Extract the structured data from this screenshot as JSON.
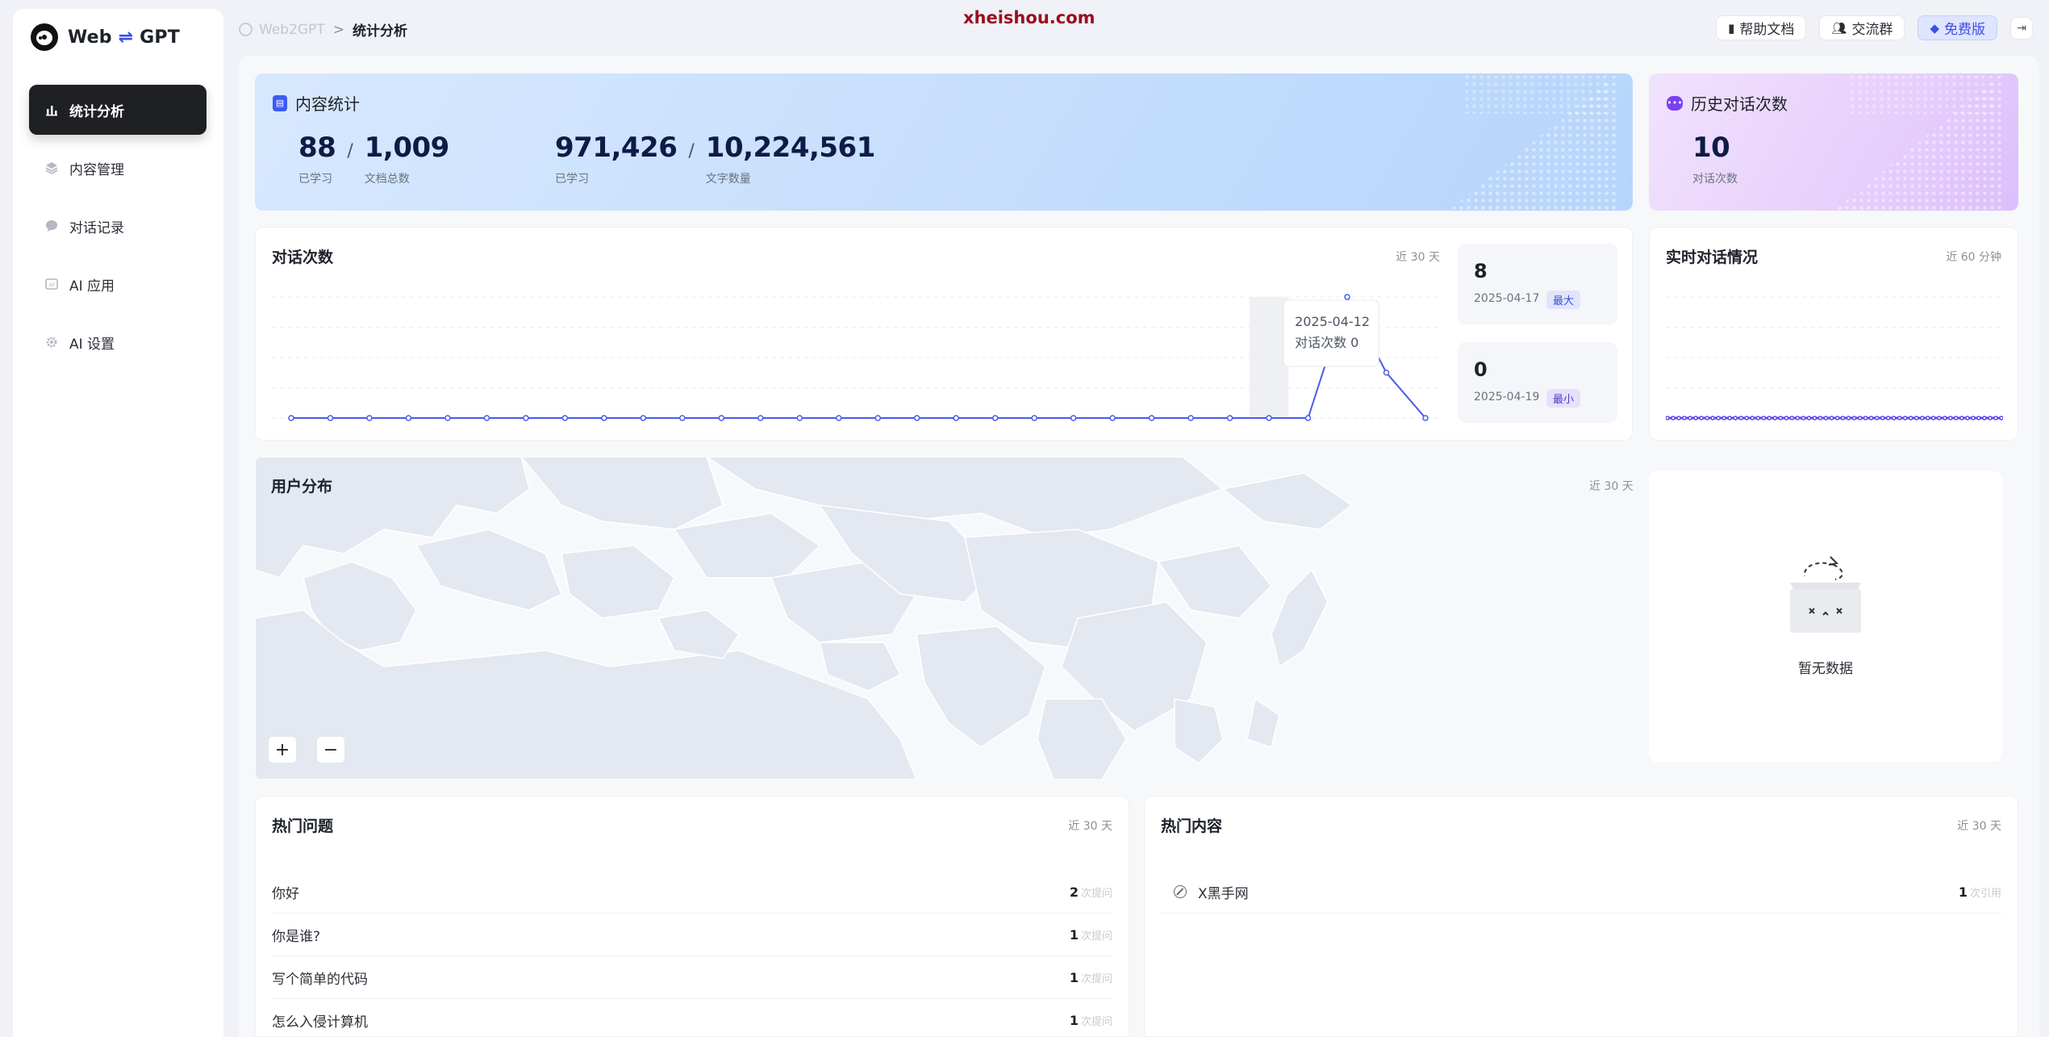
{
  "app": {
    "logo_text_left": "Web",
    "logo_swap": "⇌",
    "logo_text_right": "GPT"
  },
  "sidebar": {
    "items": [
      {
        "label": "统计分析",
        "icon": "bar-chart-icon",
        "active": true
      },
      {
        "label": "内容管理",
        "icon": "layers-icon",
        "active": false
      },
      {
        "label": "对话记录",
        "icon": "chat-bubble-icon",
        "active": false
      },
      {
        "label": "AI 应用",
        "icon": "ai-app-icon",
        "active": false
      },
      {
        "label": "AI 设置",
        "icon": "settings-gear-icon",
        "active": false
      }
    ]
  },
  "breadcrumb": {
    "home": "Web2GPT",
    "separator": ">",
    "current": "统计分析"
  },
  "watermark": "xheishou.com",
  "top_actions": {
    "help": "帮助文档",
    "community": "交流群",
    "plan": "免费版"
  },
  "content_stats": {
    "title": "内容统计",
    "learned_docs": "88",
    "learned_docs_label": "已学习",
    "total_docs": "1,009",
    "total_docs_label": "文档总数",
    "learned_chars": "971,426",
    "learned_chars_label": "已学习",
    "total_chars": "10,224,561",
    "total_chars_label": "文字数量",
    "slash": "/"
  },
  "history_stats": {
    "title": "历史对话次数",
    "count": "10",
    "label": "对话次数"
  },
  "conversation_chart": {
    "title": "对话次数",
    "range": "近 30 天",
    "tooltip_date": "2025-04-12",
    "tooltip_text": "对话次数 0",
    "max_value": "8",
    "max_date": "2025-04-17",
    "max_tag": "最大",
    "min_value": "0",
    "min_date": "2025-04-19",
    "min_tag": "最小"
  },
  "realtime": {
    "title": "实时对话情况",
    "range": "近 60 分钟"
  },
  "user_distribution": {
    "title": "用户分布",
    "range": "近 30 天",
    "zoom_in": "+",
    "zoom_out": "−",
    "empty_text": "暂无数据"
  },
  "hot_questions": {
    "title": "热门问题",
    "range": "近 30 天",
    "unit": "次提问",
    "rows": [
      {
        "text": "你好",
        "count": "2"
      },
      {
        "text": "你是谁?",
        "count": "1"
      },
      {
        "text": "写个简单的代码",
        "count": "1"
      },
      {
        "text": "怎么入侵计算机",
        "count": "1"
      }
    ]
  },
  "hot_content": {
    "title": "热门内容",
    "range": "近 30 天",
    "unit": "次引用",
    "rows": [
      {
        "text": "X黑手网",
        "count": "1"
      }
    ]
  },
  "chart_data": [
    {
      "type": "line",
      "title": "对话次数",
      "x_count": 30,
      "values": [
        0,
        0,
        0,
        0,
        0,
        0,
        0,
        0,
        0,
        0,
        0,
        0,
        0,
        0,
        0,
        0,
        0,
        0,
        0,
        0,
        0,
        0,
        0,
        0,
        0,
        0,
        0,
        8,
        3,
        0
      ],
      "ylim": [
        0,
        8
      ],
      "grid": true,
      "highlight_index": 25,
      "color": "#4a5be8"
    },
    {
      "type": "line",
      "title": "实时对话情况",
      "x_count": 60,
      "values": [
        0,
        0,
        0,
        0,
        0,
        0,
        0,
        0,
        0,
        0,
        0,
        0,
        0,
        0,
        0,
        0,
        0,
        0,
        0,
        0,
        0,
        0,
        0,
        0,
        0,
        0,
        0,
        0,
        0,
        0,
        0,
        0,
        0,
        0,
        0,
        0,
        0,
        0,
        0,
        0,
        0,
        0,
        0,
        0,
        0,
        0,
        0,
        0,
        0,
        0,
        0,
        0,
        0,
        0,
        0,
        0,
        0,
        0,
        0,
        0
      ],
      "ylim": [
        0,
        4
      ],
      "grid": true,
      "color": "#5b4ae8"
    }
  ],
  "colors": {
    "accent": "#3c4fe0",
    "sidebar_active": "#1f2023",
    "watermark": "#9b0d1f"
  }
}
